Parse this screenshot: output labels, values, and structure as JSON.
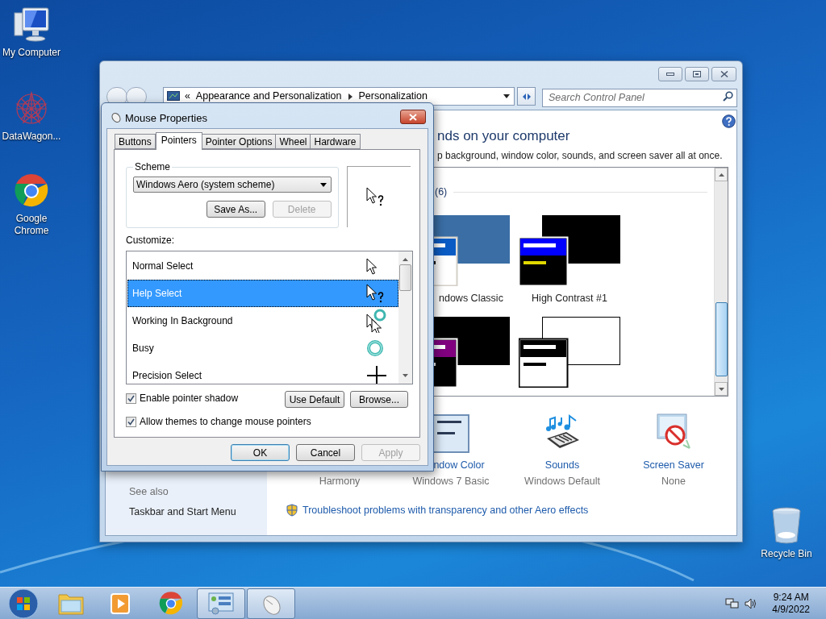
{
  "desktop": {
    "icons": [
      {
        "label": "My Computer",
        "kind": "computer"
      },
      {
        "label": "DataWagon...",
        "kind": "datawagon"
      },
      {
        "label": "Google Chrome",
        "kind": "chrome"
      },
      {
        "label": "Recycle Bin",
        "kind": "recycle"
      }
    ]
  },
  "control_panel": {
    "address": {
      "chevron": "«",
      "crumbs": [
        "Appearance and Personalization",
        "Personalization"
      ]
    },
    "search": {
      "placeholder": "Search Control Panel"
    },
    "see_also": {
      "title": "See also",
      "links": [
        "Taskbar and Start Menu"
      ]
    },
    "heading": "nds on your computer",
    "subtitle": "p background, window color, sounds, and screen saver all at once.",
    "theme_group": {
      "count": "(6)"
    },
    "themes": [
      {
        "kind": "classic",
        "label": "ndows Classic"
      },
      {
        "kind": "hc1",
        "label": "High Contrast #1"
      },
      {
        "kind": "hcblack"
      },
      {
        "kind": "hcwhite"
      }
    ],
    "settings": [
      {
        "kind": "background",
        "value": "Harmony"
      },
      {
        "kind": "color",
        "label": "ndow Color",
        "value": "Windows 7 Basic"
      },
      {
        "kind": "sounds",
        "label": "Sounds",
        "value": "Windows Default"
      },
      {
        "kind": "screensaver",
        "label": "Screen Saver",
        "value": "None"
      }
    ],
    "troubleshoot_link": "Troubleshoot problems with transparency and other Aero effects"
  },
  "mouse_properties": {
    "title": "Mouse Properties",
    "tabs": [
      {
        "label": "Buttons",
        "selected": false
      },
      {
        "label": "Pointers",
        "selected": true
      },
      {
        "label": "Pointer Options",
        "selected": false
      },
      {
        "label": "Wheel",
        "selected": false
      },
      {
        "label": "Hardware",
        "selected": false
      }
    ],
    "scheme": {
      "legend": "Scheme",
      "value": "Windows Aero (system scheme)",
      "buttons": [
        {
          "label": "Save As...",
          "disabled": false
        },
        {
          "label": "Delete",
          "disabled": true
        }
      ]
    },
    "customize_label": "Customize:",
    "pointers": [
      {
        "name": "Normal Select",
        "kind": "arrow",
        "selected": false
      },
      {
        "name": "Help Select",
        "kind": "help",
        "selected": true
      },
      {
        "name": "Working In Background",
        "kind": "working",
        "selected": false
      },
      {
        "name": "Busy",
        "kind": "busy",
        "selected": false
      },
      {
        "name": "Precision Select",
        "kind": "precision",
        "selected": false
      }
    ],
    "checkboxes": [
      {
        "label": "Enable pointer shadow",
        "checked": true
      },
      {
        "label": "Allow themes to change mouse pointers",
        "checked": true
      }
    ],
    "pointer_buttons": [
      {
        "label": "Use Default",
        "disabled": false
      },
      {
        "label": "Browse...",
        "disabled": false
      }
    ],
    "dialog_buttons": [
      {
        "label": "OK",
        "disabled": false,
        "default": true
      },
      {
        "label": "Cancel",
        "disabled": false,
        "default": false
      },
      {
        "label": "Apply",
        "disabled": true,
        "default": false
      }
    ]
  },
  "taskbar": {
    "items": [
      {
        "kind": "explorer",
        "running": false
      },
      {
        "kind": "media",
        "running": false
      },
      {
        "kind": "chrome",
        "running": false
      },
      {
        "kind": "controlpanel",
        "running": true
      },
      {
        "kind": "mouse",
        "running": true
      }
    ],
    "clock": {
      "time": "9:24 AM",
      "date": "4/9/2022"
    }
  }
}
